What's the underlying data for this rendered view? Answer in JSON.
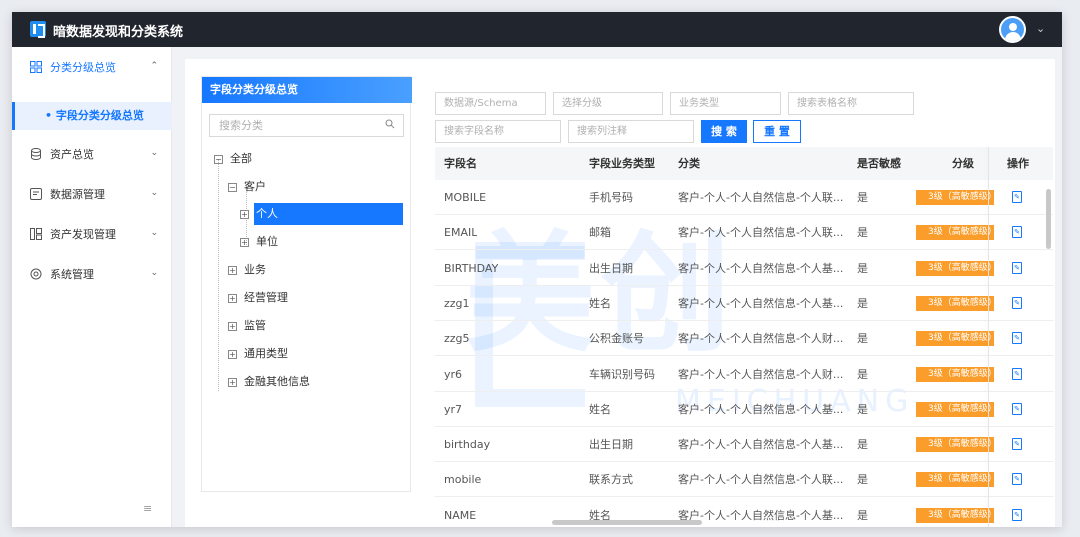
{
  "app": {
    "title": "暗数据发现和分类系统"
  },
  "sidebar": {
    "items": [
      {
        "label": "分类分级总览",
        "icon": "grid-icon",
        "caret": "⌃"
      },
      {
        "label": "资产总览",
        "icon": "database-icon",
        "caret": "⌄"
      },
      {
        "label": "数据源管理",
        "icon": "datasource-icon",
        "caret": "⌄"
      },
      {
        "label": "资产发现管理",
        "icon": "discovery-icon",
        "caret": "⌄"
      },
      {
        "label": "系统管理",
        "icon": "settings-icon",
        "caret": "⌄"
      }
    ],
    "active_sub": "• 字段分类分级总览",
    "collapse_icon": "≡"
  },
  "panel": {
    "title": "字段分类分级总览",
    "search_placeholder": "搜索分类"
  },
  "tree": {
    "root": "全部",
    "nodes": [
      {
        "label": "客户",
        "expanded": true
      },
      {
        "label": "个人",
        "selected": true
      },
      {
        "label": "单位"
      },
      {
        "label": "业务"
      },
      {
        "label": "经营管理"
      },
      {
        "label": "监管"
      },
      {
        "label": "通用类型"
      },
      {
        "label": "金融其他信息"
      }
    ]
  },
  "filters": {
    "datasource": "数据源/Schema",
    "level": "选择分级",
    "biz_type": "业务类型",
    "table_name": "搜索表格名称",
    "field_name": "搜索字段名称",
    "column_comment": "搜索列注释",
    "search_btn": "搜 索",
    "reset_btn": "重 置"
  },
  "table": {
    "headers": [
      "字段名",
      "字段业务类型",
      "分类",
      "是否敏感",
      "分级",
      "操作"
    ],
    "rows": [
      [
        "MOBILE",
        "手机号码",
        "客户-个人-个人自然信息-个人联...",
        "是",
        "3级（高敏感级）"
      ],
      [
        "EMAIL",
        "邮箱",
        "客户-个人-个人自然信息-个人联...",
        "是",
        "3级（高敏感级）"
      ],
      [
        "BIRTHDAY",
        "出生日期",
        "客户-个人-个人自然信息-个人基...",
        "是",
        "3级（高敏感级）"
      ],
      [
        "zzg1",
        "姓名",
        "客户-个人-个人自然信息-个人基...",
        "是",
        "3级（高敏感级）"
      ],
      [
        "zzg5",
        "公积金账号",
        "客户-个人-个人自然信息-个人财...",
        "是",
        "3级（高敏感级）"
      ],
      [
        "yr6",
        "车辆识别号码",
        "客户-个人-个人自然信息-个人财...",
        "是",
        "3级（高敏感级）"
      ],
      [
        "yr7",
        "姓名",
        "客户-个人-个人自然信息-个人基...",
        "是",
        "3级（高敏感级）"
      ],
      [
        "birthday",
        "出生日期",
        "客户-个人-个人自然信息-个人基...",
        "是",
        "3级（高敏感级）"
      ],
      [
        "mobile",
        "联系方式",
        "客户-个人-个人自然信息-个人联...",
        "是",
        "3级（高敏感级）"
      ],
      [
        "NAME",
        "姓名",
        "客户-个人-个人自然信息-个人基...",
        "是",
        "3级（高敏感级）"
      ]
    ],
    "op_icon": "edit-icon"
  },
  "watermark": {
    "cn": "美创",
    "en": "MEICHUANG"
  },
  "colors": {
    "accent": "#1677ff",
    "level": "#fa9d2b",
    "topbar": "#21252e"
  }
}
